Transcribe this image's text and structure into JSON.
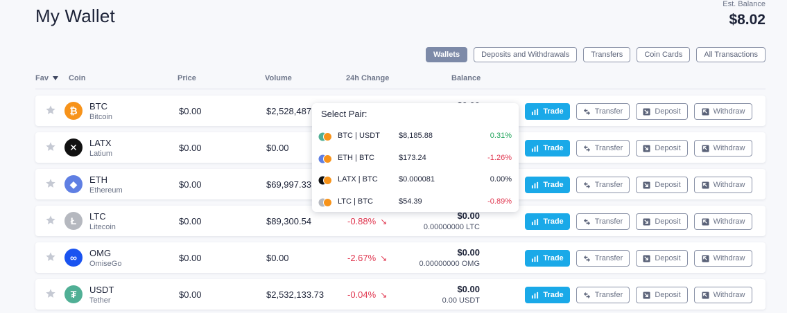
{
  "header": {
    "title": "My Wallet",
    "balance_label": "Est. Balance",
    "balance_value": "$8.02"
  },
  "tabs": [
    {
      "label": "Wallets",
      "active": true
    },
    {
      "label": "Deposits and Withdrawals",
      "active": false
    },
    {
      "label": "Transfers",
      "active": false
    },
    {
      "label": "Coin Cards",
      "active": false
    },
    {
      "label": "All Transactions",
      "active": false
    }
  ],
  "columns": {
    "fav": "Fav",
    "coin": "Coin",
    "price": "Price",
    "volume": "Volume",
    "change": "24h Change",
    "balance": "Balance"
  },
  "buttons": {
    "trade": "Trade",
    "transfer": "Transfer",
    "deposit": "Deposit",
    "withdraw": "Withdraw"
  },
  "rows": [
    {
      "symbol": "BTC",
      "name": "Bitcoin",
      "icon": "bitcoin-icon",
      "color": "#f7931a",
      "glyph": "₿",
      "price": "$0.00",
      "volume": "$2,528,487",
      "change": "",
      "balance": "$0.00",
      "balance_sub": ""
    },
    {
      "symbol": "LATX",
      "name": "Latium",
      "icon": "latium-icon",
      "color": "#111111",
      "glyph": "✕",
      "price": "$0.00",
      "volume": "$0.00",
      "change": "",
      "balance": "",
      "balance_sub": ""
    },
    {
      "symbol": "ETH",
      "name": "Ethereum",
      "icon": "ethereum-icon",
      "color": "#5f7fe3",
      "glyph": "◆",
      "price": "$0.00",
      "volume": "$69,997.33",
      "change": "",
      "balance": "",
      "balance_sub": ""
    },
    {
      "symbol": "LTC",
      "name": "Litecoin",
      "icon": "litecoin-icon",
      "color": "#b5b8bf",
      "glyph": "Ł",
      "price": "$0.00",
      "volume": "$89,300.54",
      "change": "-0.88%",
      "balance": "$0.00",
      "balance_sub": "0.00000000 LTC"
    },
    {
      "symbol": "OMG",
      "name": "OmiseGo",
      "icon": "omisego-icon",
      "color": "#1a53f0",
      "glyph": "∞",
      "price": "$0.00",
      "volume": "$0.00",
      "change": "-2.67%",
      "balance": "$0.00",
      "balance_sub": "0.00000000 OMG"
    },
    {
      "symbol": "USDT",
      "name": "Tether",
      "icon": "tether-icon",
      "color": "#50af95",
      "glyph": "₮",
      "price": "$0.00",
      "volume": "$2,532,133.73",
      "change": "-0.04%",
      "balance": "$0.00",
      "balance_sub": "0.00 USDT"
    }
  ],
  "pair_popup": {
    "title": "Select Pair:",
    "pairs": [
      {
        "name": "BTC | USDT",
        "price": "$8,185.88",
        "change": "0.31%",
        "change_color": "#1fa35a",
        "icons": [
          "tether-icon",
          "bitcoin-icon"
        ]
      },
      {
        "name": "ETH | BTC",
        "price": "$173.24",
        "change": "-1.26%",
        "change_color": "#e0364f",
        "icons": [
          "ethereum-icon",
          "bitcoin-icon"
        ]
      },
      {
        "name": "LATX | BTC",
        "price": "$0.000081",
        "change": "0.00%",
        "change_color": "#1d2338",
        "icons": [
          "latium-icon",
          "bitcoin-icon"
        ]
      },
      {
        "name": "LTC | BTC",
        "price": "$54.39",
        "change": "-0.89%",
        "change_color": "#e0364f",
        "icons": [
          "litecoin-icon",
          "bitcoin-icon"
        ]
      }
    ]
  },
  "colors": {
    "accent": "#1aa9e8",
    "negative": "#e0364f",
    "positive": "#1fa35a",
    "tab_active": "#7d8aa8"
  }
}
